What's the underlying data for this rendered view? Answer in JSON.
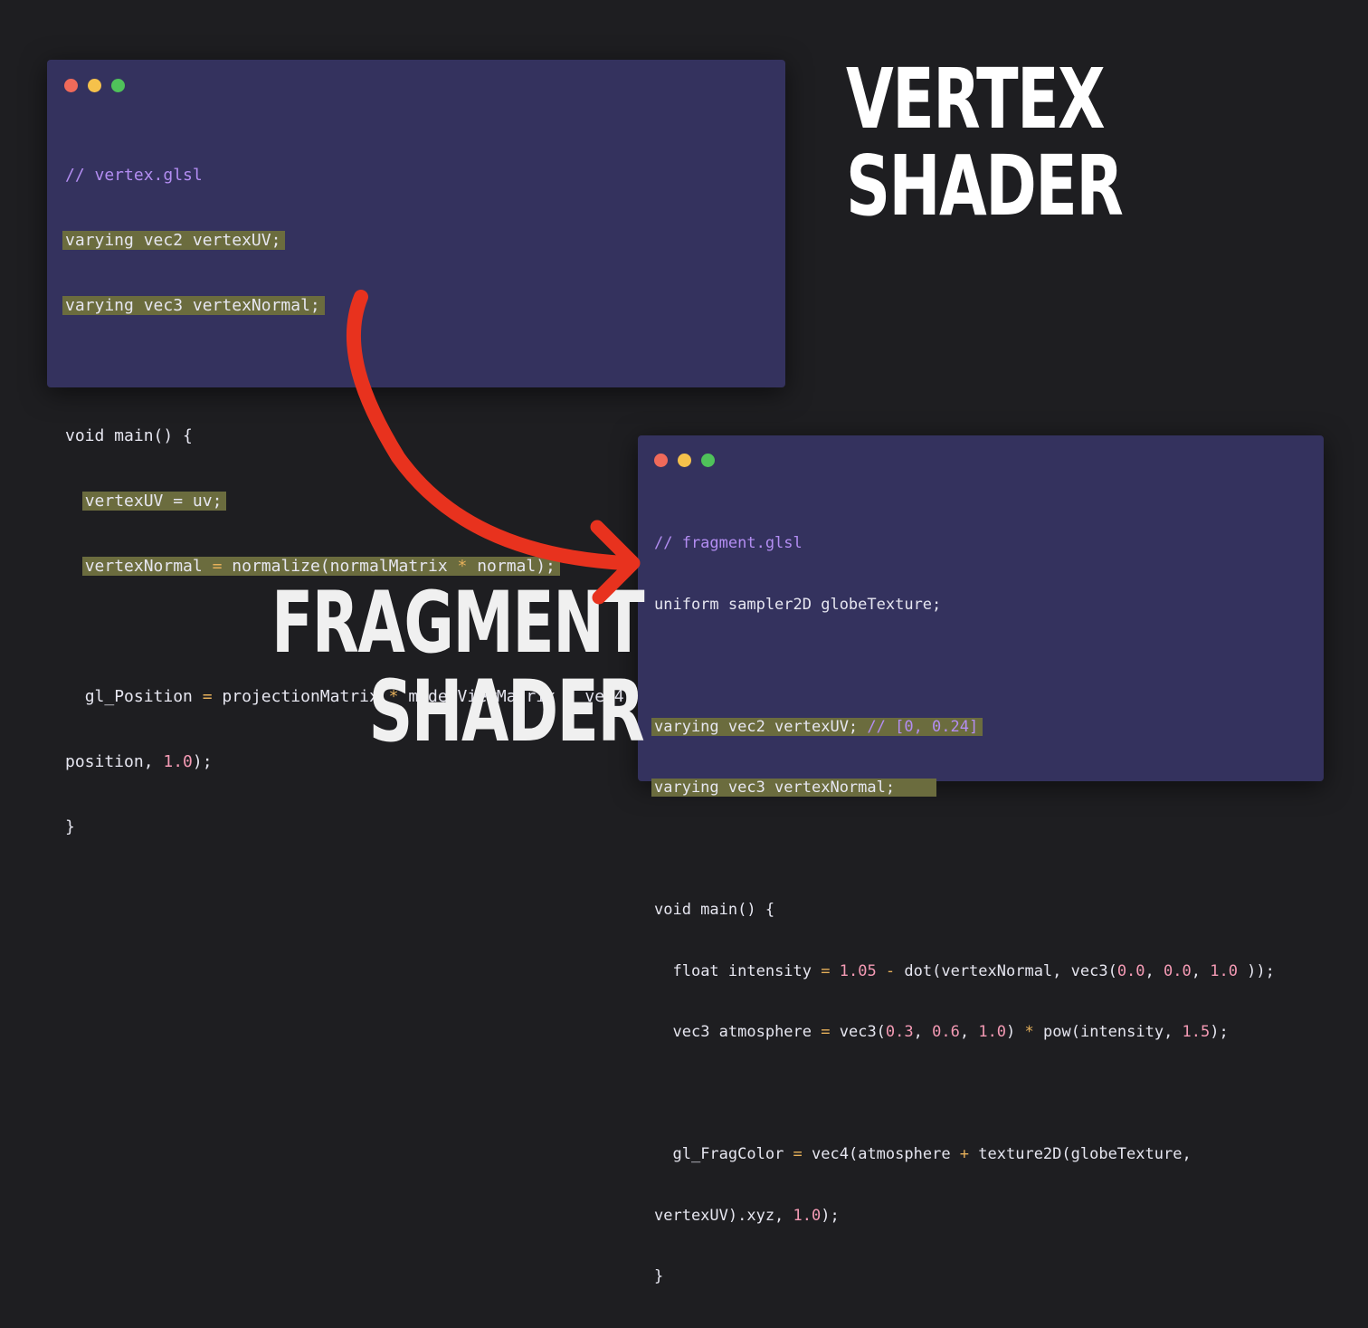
{
  "vertex_window": {
    "dots": [
      "#f06a5a",
      "#f5c14b",
      "#4fc25a"
    ],
    "comment": "// vertex.glsl",
    "line_varying_uv": "varying vec2 vertexUV;",
    "line_varying_normal": "varying vec3 vertexNormal;",
    "line_main": "void main() {",
    "line_assign_uv": "vertexUV = uv;",
    "line_assign_normal_a": "vertexNormal ",
    "line_assign_normal_b": "= ",
    "line_assign_normal_c": "normalize(normalMatrix ",
    "line_assign_normal_d": "* ",
    "line_assign_normal_e": "normal);",
    "line_gl_a": "gl_Position ",
    "line_gl_b": "= ",
    "line_gl_c": "projectionMatrix ",
    "line_gl_d": "* ",
    "line_gl_e": "modelViewMatrix ",
    "line_gl_f": "* ",
    "line_gl_g": "vec4(",
    "line_pos_a": "position, ",
    "line_pos_num": "1.0",
    "line_pos_b": ");",
    "line_close": "}"
  },
  "fragment_window": {
    "dots": [
      "#f06a5a",
      "#f5c14b",
      "#4fc25a"
    ],
    "comment": "// fragment.glsl",
    "line_uniform": "uniform sampler2D globeTexture;",
    "line_varying_uv": "varying vec2 vertexUV; ",
    "line_varying_uv_comment": "// [0, 0.24]",
    "line_varying_normal": "varying vec3 vertexNormal;",
    "line_main": "void main() {",
    "f_a": "float intensity ",
    "f_b": "= ",
    "f_c": "1.05",
    "f_d": " - ",
    "f_e": "dot(vertexNormal, vec3(",
    "f_n1": "0.0",
    "f_n2": "0.0",
    "f_n3": "1.0",
    "f_end": " ));",
    "a_a": "vec3 atmosphere ",
    "a_b": "= ",
    "a_c": "vec3(",
    "a_n1": "0.3",
    "a_n2": "0.6",
    "a_n3": "1.0",
    "a_d": ") ",
    "a_e": "* ",
    "a_f": "pow(intensity, ",
    "a_n4": "1.5",
    "a_g": ");",
    "g_a": "gl_FragColor ",
    "g_b": "= ",
    "g_c": "vec4(atmosphere ",
    "g_d": "+ ",
    "g_e": "texture2D(globeTexture,",
    "g2_a": "vertexUV).xyz, ",
    "g2_num": "1.0",
    "g2_b": ");",
    "line_close": "}"
  },
  "titles": {
    "vertex_line1": "VERTEX",
    "vertex_line2": "SHADER",
    "fragment_line1": "FRAGMENT",
    "fragment_line2": "SHADER"
  },
  "colors": {
    "background": "#1e1e21",
    "panel": "#34325e",
    "highlight": "#6b6c3e",
    "arrow": "#e8321e"
  }
}
